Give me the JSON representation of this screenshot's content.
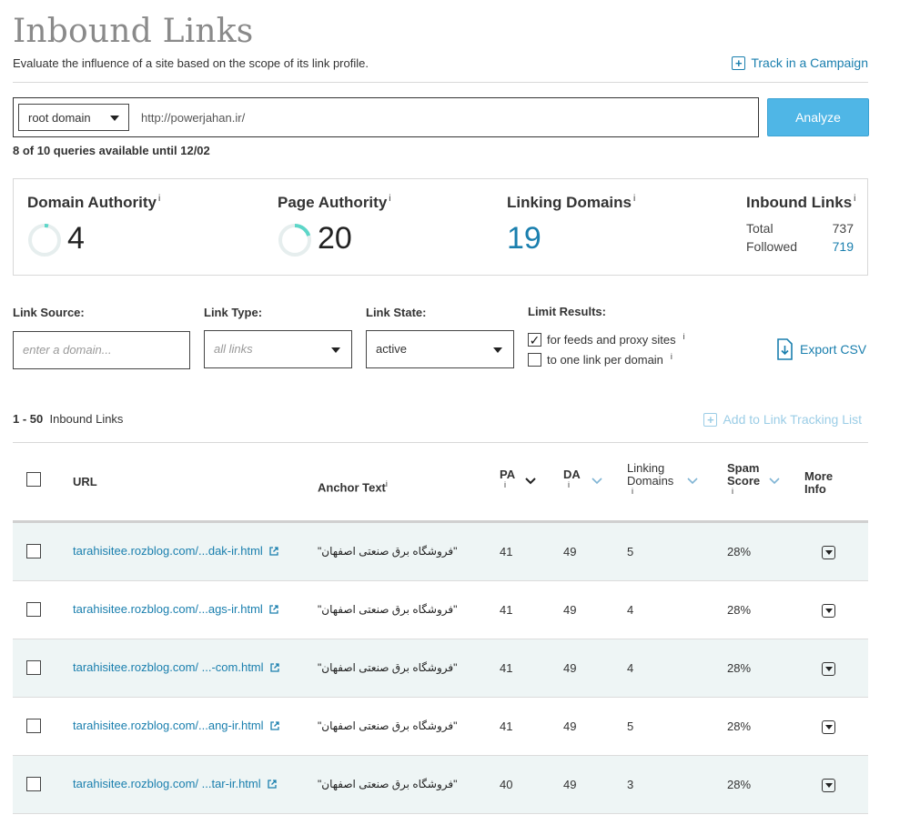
{
  "header": {
    "title": "Inbound Links",
    "subtitle": "Evaluate the influence of a site based on the scope of its link profile.",
    "track_link": "Track in a Campaign"
  },
  "search": {
    "scope": "root domain",
    "url": "http://powerjahan.ir/",
    "analyze_label": "Analyze",
    "quota": "8 of 10 queries available until 12/02"
  },
  "metrics": {
    "domain_authority": {
      "label": "Domain Authority",
      "info": "i",
      "value": "4",
      "score": 4
    },
    "page_authority": {
      "label": "Page Authority",
      "info": "i",
      "value": "20",
      "score": 20
    },
    "linking_domains": {
      "label": "Linking Domains",
      "info": "i",
      "value": "19"
    },
    "inbound_links": {
      "label": "Inbound Links",
      "info": "i",
      "total_label": "Total",
      "total": "737",
      "followed_label": "Followed",
      "followed": "719"
    }
  },
  "filters": {
    "link_source": {
      "label": "Link Source:",
      "placeholder": "enter a domain..."
    },
    "link_type": {
      "label": "Link Type:",
      "value": "all links"
    },
    "link_state": {
      "label": "Link State:",
      "value": "active"
    },
    "limit_results": {
      "label": "Limit Results:",
      "opt1": "for feeds and proxy sites",
      "opt1_checked": true,
      "opt2": "to one link per domain",
      "opt2_checked": false,
      "info": "i"
    },
    "export_label": "Export CSV"
  },
  "results": {
    "range": "1 - 50",
    "range_label": "Inbound Links",
    "add_tracking": "Add to Link Tracking List"
  },
  "table": {
    "columns": {
      "url": "URL",
      "anchor": "Anchor Text",
      "pa": "PA",
      "da": "DA",
      "linking_1": "Linking",
      "linking_2": "Domains",
      "spam_1": "Spam",
      "spam_2": "Score",
      "more_1": "More",
      "more_2": "Info",
      "info": "i"
    },
    "rows": [
      {
        "url": "tarahisitee.rozblog.com/...dak-ir.html",
        "anchor": "\"فروشگاه برق صنعتی اصفهان\"",
        "pa": "41",
        "da": "49",
        "ld": "5",
        "spam": "28%"
      },
      {
        "url": "tarahisitee.rozblog.com/...ags-ir.html",
        "anchor": "\"فروشگاه برق صنعتی اصفهان\"",
        "pa": "41",
        "da": "49",
        "ld": "4",
        "spam": "28%"
      },
      {
        "url": "tarahisitee.rozblog.com/ ...-com.html",
        "anchor": "\"فروشگاه برق صنعتی اصفهان\"",
        "pa": "41",
        "da": "49",
        "ld": "4",
        "spam": "28%"
      },
      {
        "url": "tarahisitee.rozblog.com/...ang-ir.html",
        "anchor": "\"فروشگاه برق صنعتی اصفهان\"",
        "pa": "41",
        "da": "49",
        "ld": "5",
        "spam": "28%"
      },
      {
        "url": "tarahisitee.rozblog.com/ ...tar-ir.html",
        "anchor": "\"فروشگاه برق صنعتی اصفهان\"",
        "pa": "40",
        "da": "49",
        "ld": "3",
        "spam": "28%"
      }
    ]
  },
  "colors": {
    "accent": "#1a7fae",
    "button": "#4fb6e6",
    "ring": "#5dd6c8",
    "row_shade": "#eef5f5"
  }
}
